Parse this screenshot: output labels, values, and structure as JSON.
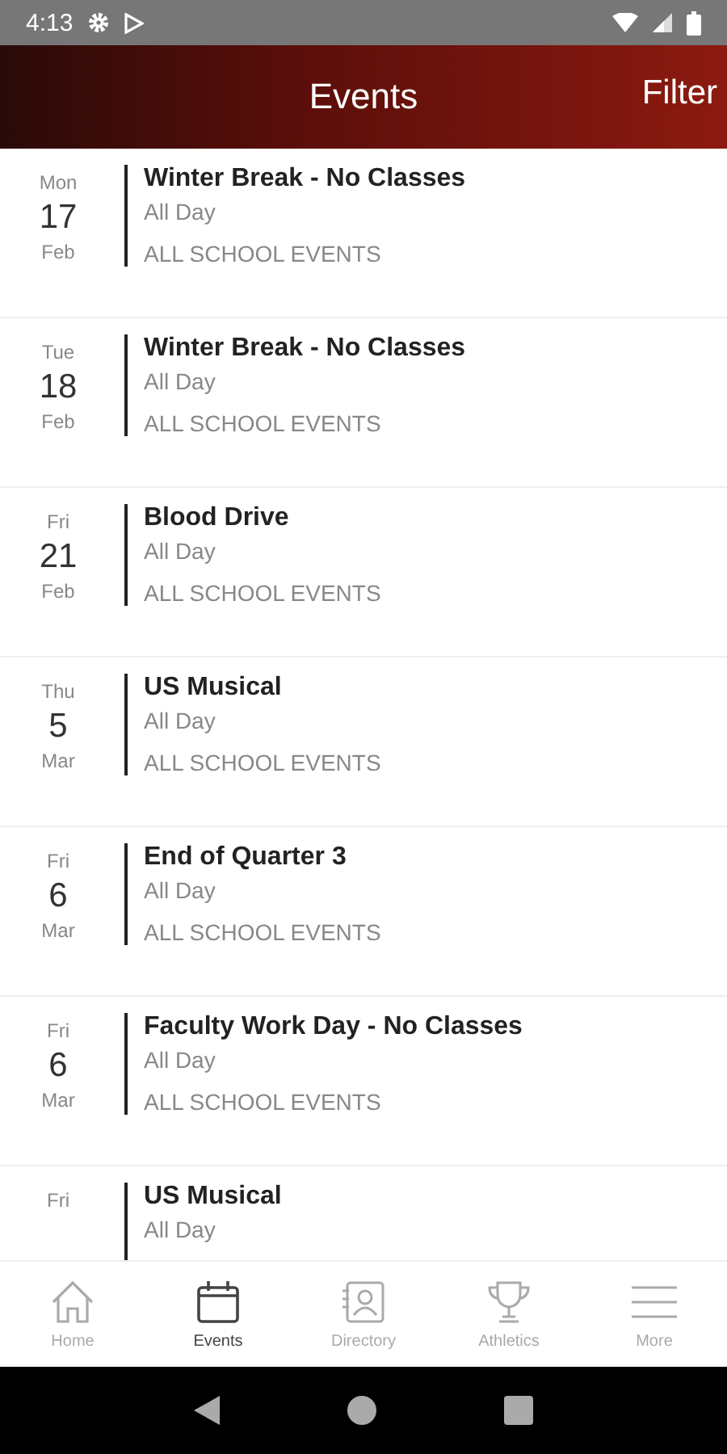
{
  "status_bar": {
    "time": "4:13"
  },
  "header": {
    "title": "Events",
    "action": "Filter"
  },
  "events": [
    {
      "weekday": "Mon",
      "day": "17",
      "month": "Feb",
      "title": "Winter Break - No Classes",
      "time": "All Day",
      "category": "ALL SCHOOL EVENTS"
    },
    {
      "weekday": "Tue",
      "day": "18",
      "month": "Feb",
      "title": "Winter Break - No Classes",
      "time": "All Day",
      "category": "ALL SCHOOL EVENTS"
    },
    {
      "weekday": "Fri",
      "day": "21",
      "month": "Feb",
      "title": "Blood Drive",
      "time": "All Day",
      "category": "ALL SCHOOL EVENTS"
    },
    {
      "weekday": "Thu",
      "day": "5",
      "month": "Mar",
      "title": "US Musical",
      "time": "All Day",
      "category": "ALL SCHOOL EVENTS"
    },
    {
      "weekday": "Fri",
      "day": "6",
      "month": "Mar",
      "title": "End of Quarter 3",
      "time": "All Day",
      "category": "ALL SCHOOL EVENTS"
    },
    {
      "weekday": "Fri",
      "day": "6",
      "month": "Mar",
      "title": "Faculty Work Day - No Classes",
      "time": "All Day",
      "category": "ALL SCHOOL EVENTS"
    },
    {
      "weekday": "Fri",
      "title": "US Musical",
      "time": "All Day"
    }
  ],
  "tabs": [
    {
      "kind": "home",
      "label": "Home",
      "selected": false
    },
    {
      "kind": "events",
      "label": "Events",
      "selected": true
    },
    {
      "kind": "directory",
      "label": "Directory",
      "selected": false
    },
    {
      "kind": "athletics",
      "label": "Athletics",
      "selected": false
    },
    {
      "kind": "more",
      "label": "More",
      "selected": false
    }
  ]
}
